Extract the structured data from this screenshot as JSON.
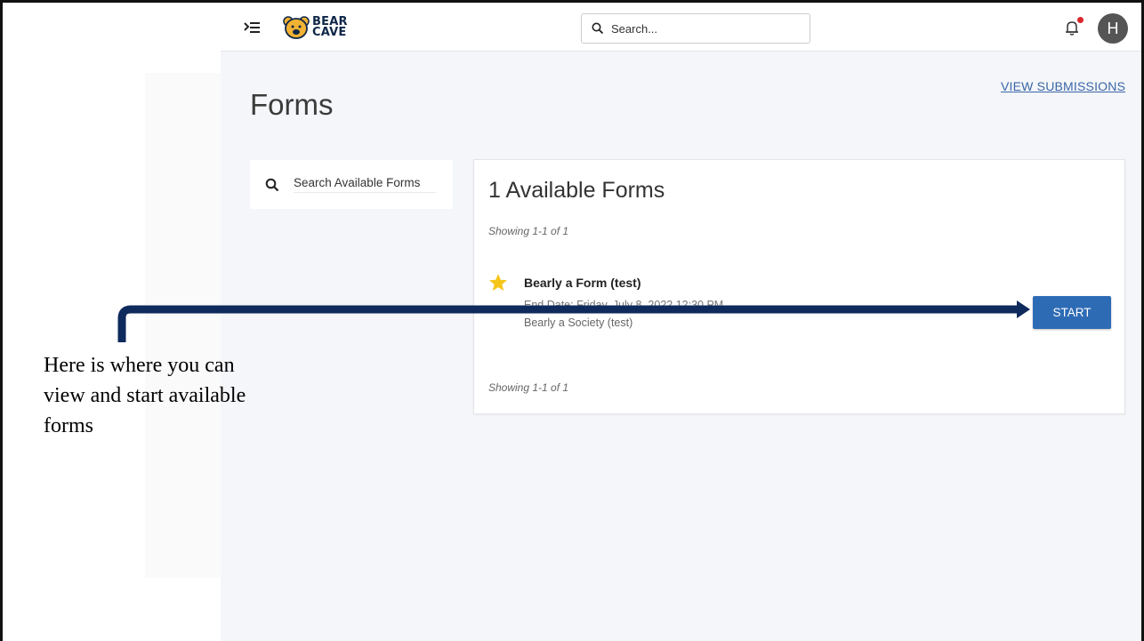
{
  "header": {
    "logo_line1": "BEAR",
    "logo_line2": "CAVE",
    "search_placeholder": "Search...",
    "avatar_initial": "H",
    "icons": [
      "menu-collapse-icon",
      "bear-logo-icon",
      "search-icon",
      "bell-icon",
      "notification-dot"
    ]
  },
  "page": {
    "title": "Forms",
    "view_submissions": "VIEW SUBMISSIONS"
  },
  "sidebar": {
    "search_placeholder": "Search Available Forms"
  },
  "card": {
    "title": "1 Available Forms",
    "showing_top": "Showing 1-1 of 1",
    "showing_bottom": "Showing 1-1 of 1",
    "forms": [
      {
        "name": "Bearly a Form (test)",
        "end_date": "End Date: Friday, July 8, 2022 12:30 PM",
        "society": "Bearly a Society (test)",
        "action": "START",
        "favorite": true
      }
    ]
  },
  "annotation": {
    "text": "Here is where you can view and start available forms"
  },
  "colors": {
    "accent": "#2e6bb5",
    "link": "#3a66a8",
    "arrow": "#0f2a5c",
    "star": "#f5c518",
    "notification": "#d9262b"
  }
}
